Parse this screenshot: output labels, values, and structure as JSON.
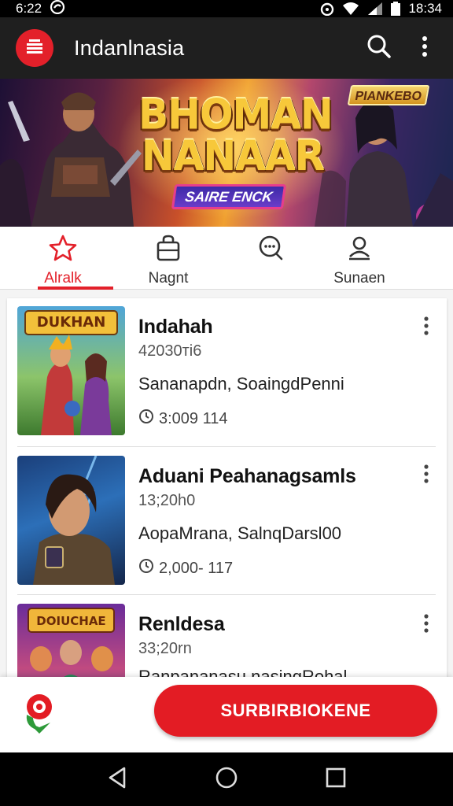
{
  "status_bar": {
    "time": "6:22",
    "clock": "18:34"
  },
  "app_bar": {
    "title": "Indanlnasia"
  },
  "hero": {
    "title": "BHOMAN NANAAR",
    "badge": "SAIRE ENCK",
    "corner_badge": "PIANKEBO"
  },
  "tabs": [
    {
      "label": "Alralk",
      "icon": "star-icon",
      "active": true
    },
    {
      "label": "Nagnt",
      "icon": "bag-icon",
      "active": false
    },
    {
      "label": "",
      "icon": "chat-icon",
      "active": false
    },
    {
      "label": "Sunaen",
      "icon": "profile-icon",
      "active": false
    }
  ],
  "items": [
    {
      "title": "Indahah",
      "meta": "42030ті6",
      "desc": "Sananapdn, SoaingdPenni",
      "stats": "3:009  114",
      "thumb_title": "DUKHAN"
    },
    {
      "title": "Aduani Peahanagsamls",
      "meta": "13;20h0",
      "desc": "AopaMrana, SalnqDarsl00",
      "stats": "2,000- 117",
      "thumb_title": ""
    },
    {
      "title": "Renldesa",
      "meta": "33;20rn",
      "desc": "Ranpananasu nasingRohal",
      "stats": "",
      "thumb_title": "DOIUCHAE"
    }
  ],
  "action_bar": {
    "subscribe_label": "SURBIRBIOKENE"
  },
  "colors": {
    "accent": "#e31c24",
    "app_bar": "#1f1f1f",
    "text": "#111111"
  }
}
